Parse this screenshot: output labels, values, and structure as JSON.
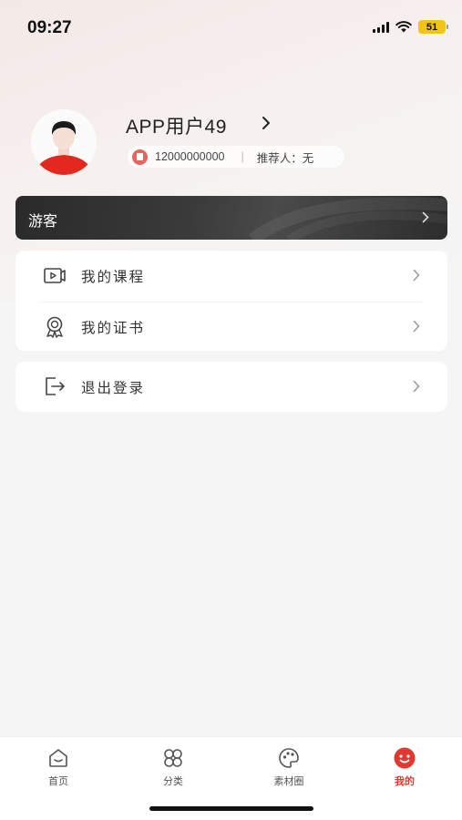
{
  "status_bar": {
    "time": "09:27",
    "battery": "51"
  },
  "profile": {
    "user_name": "APP用户49",
    "phone": "12000000000",
    "referrer": "推荐人：无"
  },
  "guest_bar": {
    "label": "游客"
  },
  "menu": {
    "group1": [
      {
        "label": "我的课程",
        "icon": "video-icon"
      },
      {
        "label": "我的证书",
        "icon": "certificate-icon"
      }
    ],
    "group2": [
      {
        "label": "退出登录",
        "icon": "logout-icon"
      }
    ]
  },
  "tabbar": {
    "items": [
      {
        "label": "首页",
        "icon": "home-icon",
        "active": false
      },
      {
        "label": "分类",
        "icon": "category-icon",
        "active": false
      },
      {
        "label": "素材圈",
        "icon": "palette-icon",
        "active": false
      },
      {
        "label": "我的",
        "icon": "smile-icon",
        "active": true
      }
    ]
  },
  "colors": {
    "accent": "#e2382f",
    "guest_bar": "#2f2f2f",
    "battery": "#f3c318"
  }
}
